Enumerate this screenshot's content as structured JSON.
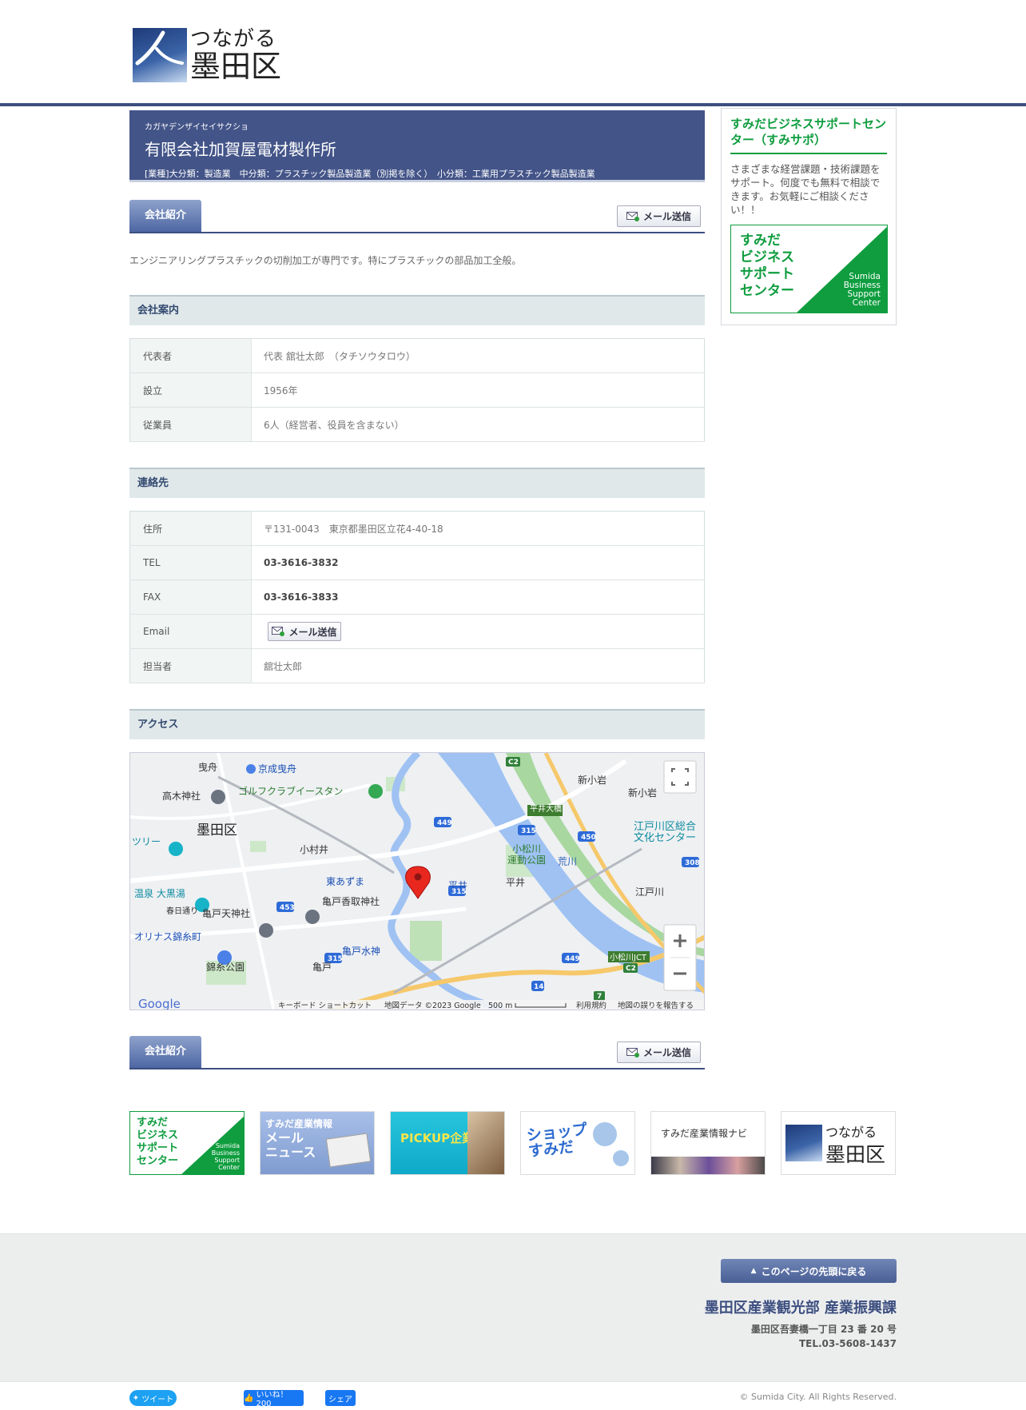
{
  "header": {
    "logo_line1": "つながる",
    "logo_line2": "墨田区"
  },
  "company": {
    "kana": "カガヤデンザイセイサクショ",
    "name": "有限会社加賀屋電材製作所",
    "category": "[業種]大分類：製造業　中分類：プラスチック製品製造業（別掲を除く）　小分類：工業用プラスチック製品製造業"
  },
  "section_tab": "会社紹介",
  "mail_button": "メール送信",
  "intro": "エンジニアリングプラスチックの切削加工が専門です。特にプラスチックの部品加工全般。",
  "company_info": {
    "heading": "会社案内",
    "rows": [
      {
        "label": "代表者",
        "value": "代表 舘壮太郎　（タチソウタロウ）"
      },
      {
        "label": "設立",
        "value": "1956年"
      },
      {
        "label": "従業員",
        "value": "6人（経営者、役員を含まない）"
      }
    ]
  },
  "contact": {
    "heading": "連絡先",
    "address_label": "住所",
    "address": "〒131-0043　東京都墨田区立花4-40-18",
    "tel_label": "TEL",
    "tel": "03-3616-3832",
    "fax_label": "FAX",
    "fax": "03-3616-3833",
    "email_label": "Email",
    "person_label": "担当者",
    "person": "舘壮太郎"
  },
  "access": {
    "heading": "アクセス",
    "map_labels": {
      "ward": "墨田区",
      "keisei": "京成曳舟",
      "hikifune": "曳舟",
      "takagi": "高木神社",
      "golf": "ゴルフクラブイースタン",
      "tree": "ツリー",
      "komurai": "小村井",
      "higashiazuma": "東あずま",
      "kameido_katori": "亀戸香取神社",
      "kameido_tenjin": "亀戸天神社",
      "onsen": "温泉 大黒湯",
      "olinas": "オリナス錦糸町",
      "kinshi_park": "錦糸公園",
      "kameido_suijin": "亀戸水神",
      "kameido": "亀戸",
      "hirai": "平井",
      "komatsugawa_park": "小松川\n運動公園",
      "arakawa": "荒川",
      "shinkoiwa": "新小岩",
      "edogawa_center": "江戸川区総合\n文化センター",
      "edogawa": "江戸川",
      "komatsugawa_jct": "小松川JCT",
      "hirai_bridge": "平井大橋",
      "kasumi": "春日通り",
      "r449": "449",
      "r315": "315",
      "r450": "450",
      "r453": "453",
      "r308": "308",
      "r14": "14",
      "r7": "7",
      "c2": "C2",
      "footer_keyboard": "キーボード ショートカット",
      "footer_data": "地図データ ©2023 Google",
      "footer_scale": "500 m",
      "footer_terms": "利用規約",
      "footer_report": "地図の誤りを報告する",
      "google": "Google"
    }
  },
  "sidebar": {
    "title": "すみだビジネスサポートセンター（すみサポ）",
    "text": "さまざまな経営課題・技術課題をサポート。何度でも無料で相談できます。お気軽にご相談ください！！",
    "logo_jp": "すみだ\nビジネス\nサポート\nセンター",
    "logo_en": "Sumida\nBusiness\nSupport\nCenter"
  },
  "banners": {
    "sbsc_jp": "すみだ\nビジネス\nサポート\nセンター",
    "sbsc_en": "Sumida\nBusiness\nSupport\nCenter",
    "news_title": "すみだ産業情報",
    "news_sub": "メール\nニュース",
    "pickup": "PICKUP企業",
    "shop": "ショップ\nすみだ",
    "navi": "すみだ産業情報ナビ",
    "tsunagaru1": "つながる",
    "tsunagaru2": "墨田区"
  },
  "footer": {
    "back_to_top": "このページの先頭に戻る",
    "org": "墨田区産業観光部 産業振興課",
    "address": "墨田区吾妻橋一丁目 23 番 20 号",
    "tel": "TEL.03-5608-1437",
    "tweet": "ツイート",
    "like": "いいね！ 200",
    "share": "シェア",
    "copyright": "© Sumida City. All Rights Reserved."
  },
  "colors": {
    "navy": "#435488",
    "green": "#0f9d3f",
    "river": "#9fc2f3"
  }
}
